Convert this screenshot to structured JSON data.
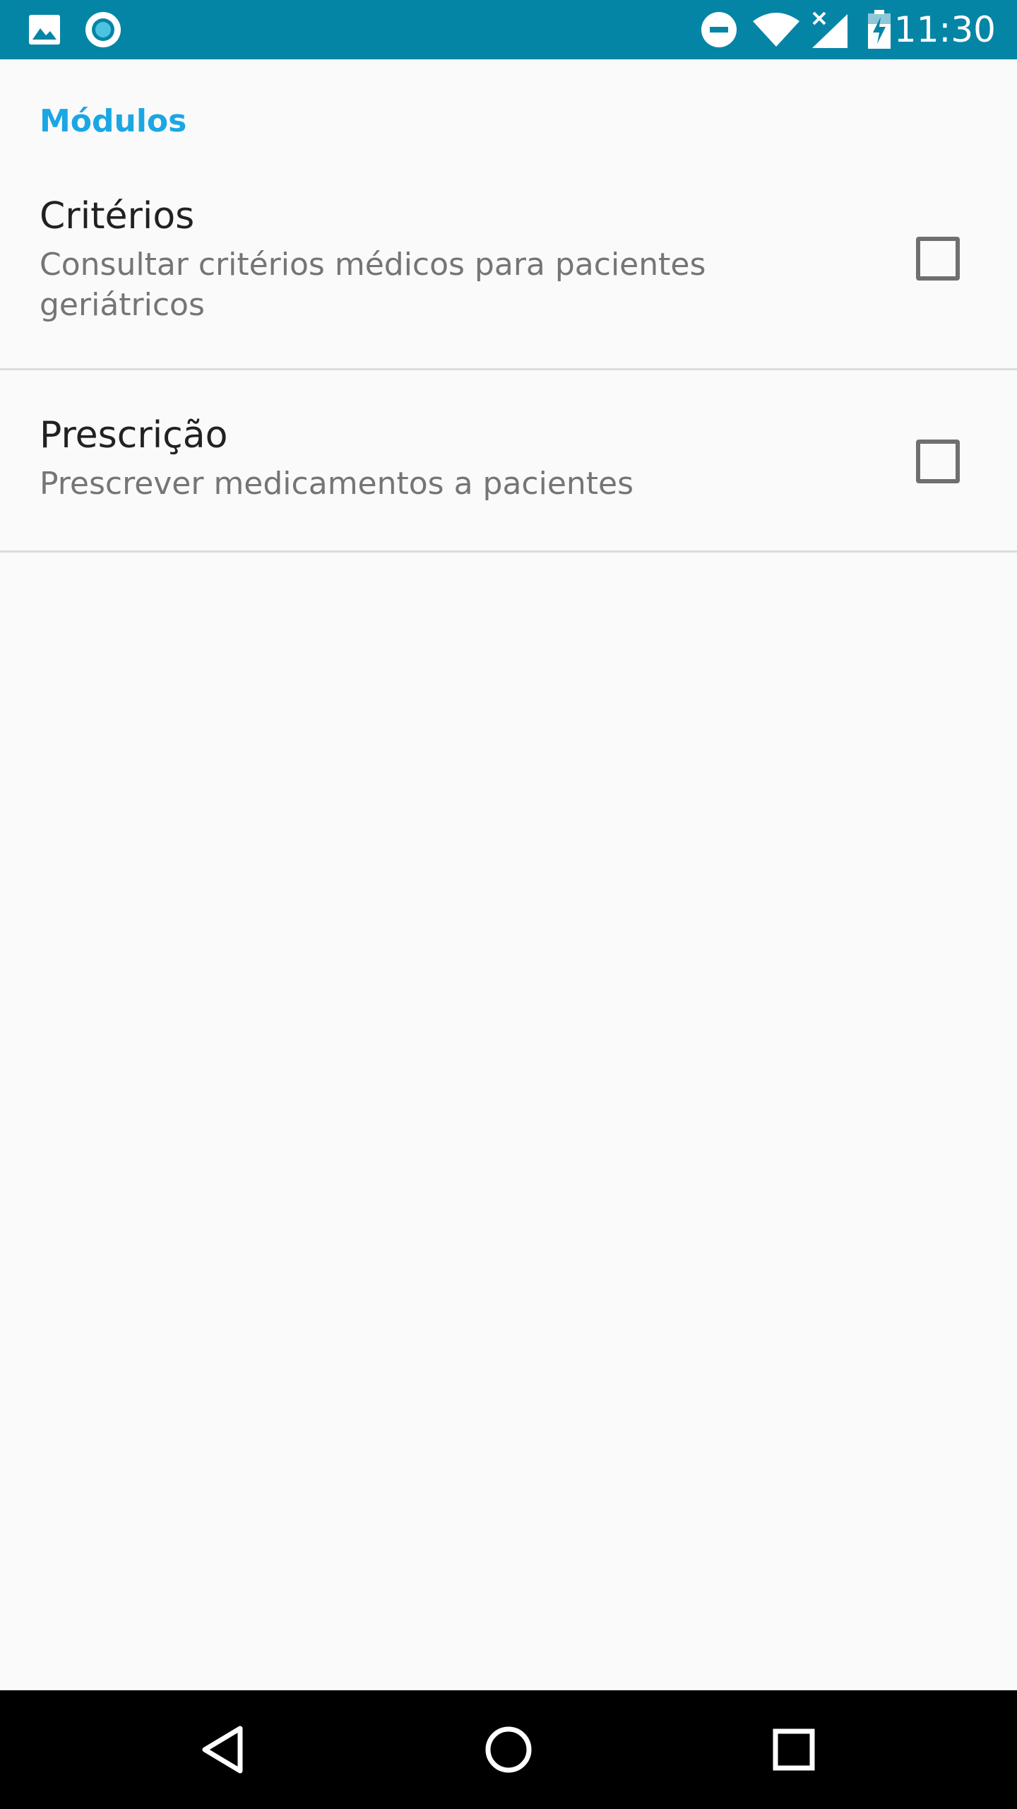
{
  "status_bar": {
    "time": "11:30",
    "icons": [
      "gallery-icon",
      "circle-notification-icon",
      "do-not-disturb-icon",
      "wifi-icon",
      "cell-signal-no-data-icon",
      "battery-charging-icon"
    ],
    "background_color": "#0585a6"
  },
  "section": {
    "header": "Módulos",
    "accent_color": "#1aa7e3"
  },
  "preferences": [
    {
      "title": "Critérios",
      "summary": "Consultar critérios médicos para pacientes geriátricos",
      "checked": false
    },
    {
      "title": "Prescrição",
      "summary": "Prescrever medicamentos a pacientes",
      "checked": false
    }
  ],
  "nav_bar": {
    "buttons": [
      "back-icon",
      "home-icon",
      "recents-icon"
    ]
  }
}
